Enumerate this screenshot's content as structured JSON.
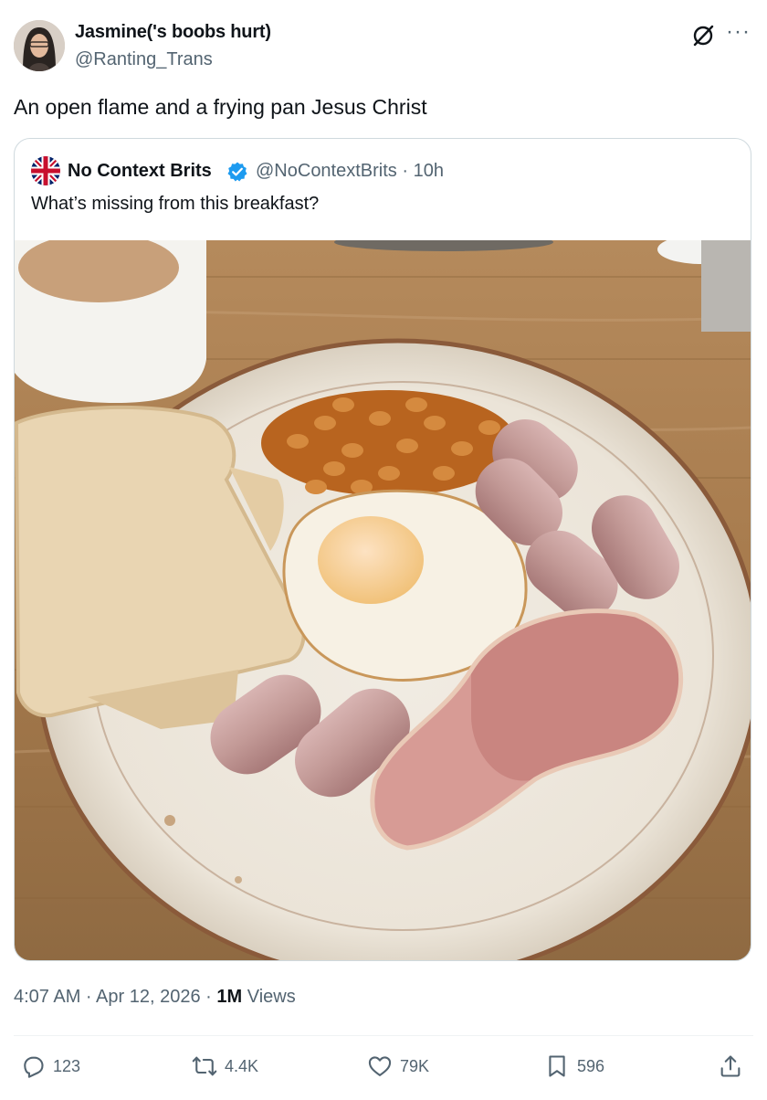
{
  "tweet": {
    "author_name": "Jasmine('s boobs hurt)",
    "author_handle": "@Ranting_Trans",
    "text": "An open flame and a frying pan Jesus Christ",
    "timestamp": "4:07 AM · Apr 12, 2026 · ",
    "views_count": "1M",
    "views_label": " Views"
  },
  "quote": {
    "author_name": "No Context Brits",
    "meta": "@NoContextBrits · 10h",
    "text": "What’s missing from this breakfast?"
  },
  "actions": {
    "replies": "123",
    "retweets": "4.4K",
    "likes": "79K",
    "bookmarks": "596"
  },
  "icons": [
    "grok-icon",
    "more-icon",
    "verified-icon",
    "reply-icon",
    "retweet-icon",
    "like-icon",
    "bookmark-icon",
    "share-icon"
  ],
  "colors": {
    "text_primary": "#0f1419",
    "text_secondary": "#536471",
    "verified": "#1d9bf0",
    "border": "#cfd9de"
  }
}
